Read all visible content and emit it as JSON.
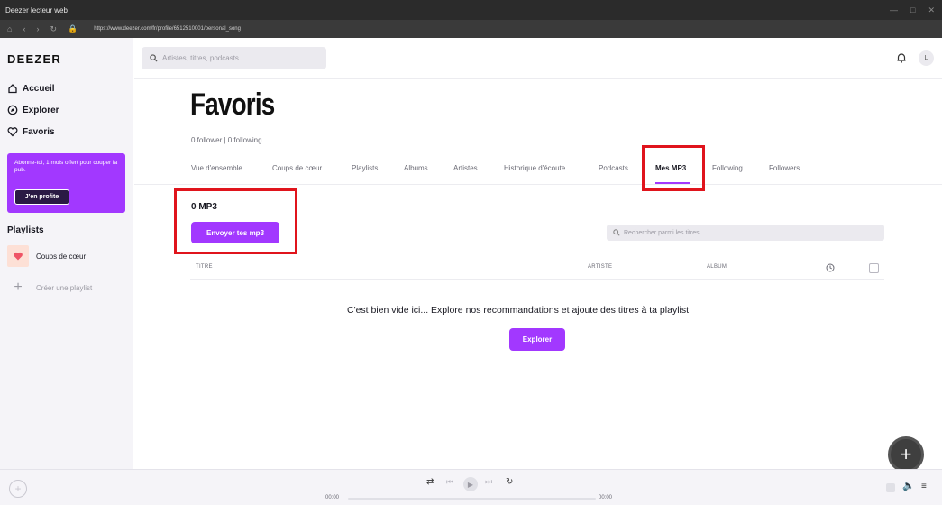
{
  "window": {
    "title": "Deezer lecteur web"
  },
  "browser": {
    "url": "https://www.deezer.com/fr/profile/6512510001/personal_song"
  },
  "sidebar": {
    "logo": "DEEZER",
    "nav": [
      {
        "label": "Accueil",
        "icon": "home-icon"
      },
      {
        "label": "Explorer",
        "icon": "compass-icon"
      },
      {
        "label": "Favoris",
        "icon": "heart-icon"
      }
    ],
    "promo": {
      "text": "Abonne-toi, 1 mois offert pour couper la pub.",
      "button": "J'en profite"
    },
    "playlists_heading": "Playlists",
    "playlists": [
      {
        "label": "Coups de cœur",
        "icon": "heart-icon"
      },
      {
        "label": "Créer une playlist",
        "icon": "plus-icon"
      }
    ]
  },
  "header": {
    "search_placeholder": "Artistes, titres, podcasts...",
    "avatar_initial": "L"
  },
  "profile": {
    "title": "Favoris",
    "followers": "0 follower | 0 following",
    "tabs": [
      "Vue d'ensemble",
      "Coups de cœur",
      "Playlists",
      "Albums",
      "Artistes",
      "Historique d'écoute",
      "Podcasts",
      "Mes MP3",
      "Following",
      "Followers"
    ],
    "active_tab": "Mes MP3"
  },
  "content": {
    "count": "0 MP3",
    "upload_button": "Envoyer tes mp3",
    "track_search_placeholder": "Rechercher parmi les titres",
    "columns": {
      "title": "TITRE",
      "artist": "ARTISTE",
      "album": "ALBUM"
    },
    "empty_message": "C'est bien vide ici... Explore nos recommandations et ajoute des titres à ta playlist",
    "explore_button": "Explorer"
  },
  "player": {
    "current_time": "00:00",
    "duration": "00:00"
  },
  "colors": {
    "accent": "#a238ff",
    "highlight": "#e0141c"
  }
}
